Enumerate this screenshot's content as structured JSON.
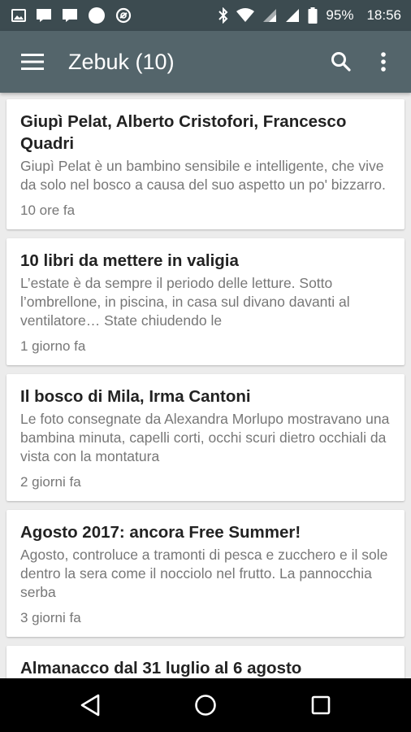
{
  "status_bar": {
    "battery_percent": "95%",
    "time": "18:56",
    "left_icons": [
      "image-notification-icon",
      "message-icon",
      "message-icon",
      "circle-notification-icon",
      "data-saver-icon"
    ],
    "right_icons": [
      "bluetooth-icon",
      "wifi-icon",
      "signal-icon",
      "signal-icon",
      "battery-icon"
    ]
  },
  "app_bar": {
    "title": "Zebuk (10)",
    "menu_icon": "hamburger-menu-icon",
    "search_icon": "search-icon",
    "overflow_icon": "more-vert-icon"
  },
  "feed": {
    "items": [
      {
        "title": "Giupì Pelat, Alberto Cristofori, Francesco Quadri",
        "excerpt": "Giupì Pelat è un bambino sensibile e intelligente, che vive da solo nel bosco a causa del suo aspetto un po' bizzarro.",
        "time": "10 ore fa"
      },
      {
        "title": "10 libri da mettere in valigia",
        "excerpt": "L’estate è da sempre il periodo delle letture. Sotto l’ombrellone, in piscina, in casa sul divano davanti al ventilatore… State chiudendo le",
        "time": "1 giorno fa"
      },
      {
        "title": "Il bosco di Mila, Irma Cantoni",
        "excerpt": "Le foto consegnate da Alexandra Morlupo mostravano una bambina minuta, capelli corti, occhi scuri dietro occhiali da vista con la montatura",
        "time": "2 giorni fa"
      },
      {
        "title": "Agosto 2017: ancora Free Summer!",
        "excerpt": "Agosto, controluce a tramonti di pesca e zucchero e il sole dentro la sera come il nocciolo nel frutto. La pannocchia serba",
        "time": "3 giorni fa"
      },
      {
        "title": "Almanacco dal 31 luglio al 6 agosto",
        "excerpt": "",
        "time": ""
      }
    ]
  },
  "nav_bar": {
    "back_icon": "back-triangle-icon",
    "home_icon": "home-circle-icon",
    "recents_icon": "recents-square-icon"
  },
  "colors": {
    "status_bar": "#3c4b50",
    "app_bar": "#54656b",
    "background": "#ececec",
    "card": "#ffffff",
    "title_text": "#222222",
    "secondary_text": "#777777",
    "nav_bar": "#000000"
  }
}
